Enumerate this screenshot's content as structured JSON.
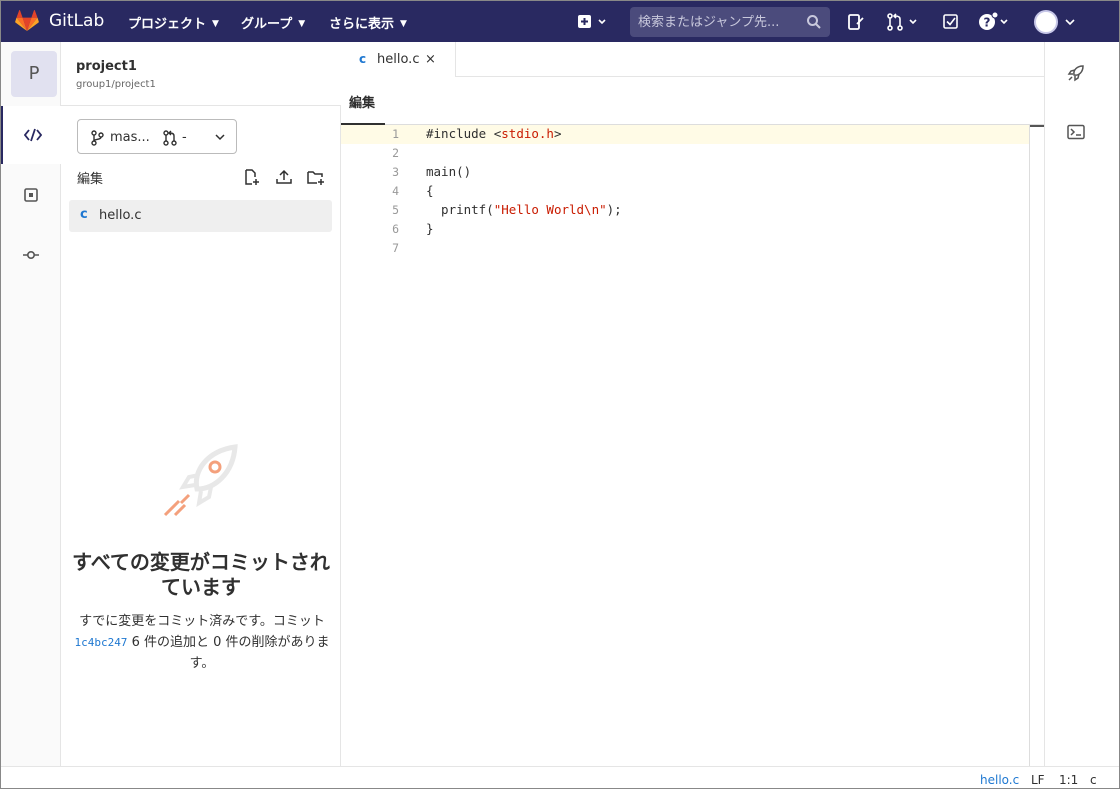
{
  "topnav": {
    "brand": "GitLab",
    "projects_label": "プロジェクト",
    "groups_label": "グループ",
    "more_label": "さらに表示",
    "search_placeholder": "検索またはジャンプ先..."
  },
  "project": {
    "avatar_letter": "P",
    "name": "project1",
    "path": "group1/project1"
  },
  "sidebar": {
    "branch_label": "mas...",
    "mr_label": "-",
    "edit_label": "編集",
    "files": [
      {
        "type_icon": "c",
        "name": "hello.c"
      }
    ],
    "empty_title": "すべての変更がコミットされています",
    "empty_desc_before": "すでに変更をコミット済みです。コミット",
    "empty_commit_hash": "1c4bc247",
    "empty_desc_after": "6 件の追加と 0 件の削除があります。"
  },
  "editor": {
    "tab_type_icon": "c",
    "tab_name": "hello.c",
    "tab_close": "×",
    "mode_label": "編集",
    "lines": [
      {
        "n": "1",
        "code": "#include <stdio.h>"
      },
      {
        "n": "2",
        "code": ""
      },
      {
        "n": "3",
        "code": "main()"
      },
      {
        "n": "4",
        "code": "{"
      },
      {
        "n": "5",
        "code": "  printf(\"Hello World\\n\");"
      },
      {
        "n": "6",
        "code": "}"
      },
      {
        "n": "7",
        "code": ""
      }
    ]
  },
  "statusbar": {
    "file": "hello.c",
    "eol": "LF",
    "position": "1:1",
    "language": "c"
  },
  "colors": {
    "topbar": "#292961",
    "link": "#1f78d1",
    "string": "#c91b00",
    "current_line": "#fffbe6"
  }
}
